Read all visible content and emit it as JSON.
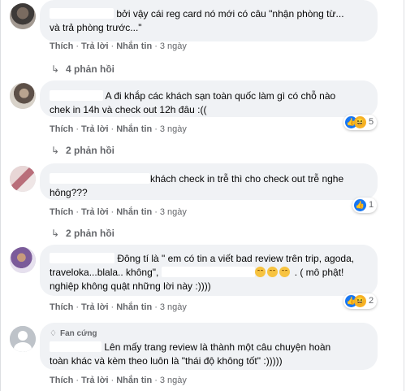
{
  "actions": {
    "like": "Thích",
    "reply": "Trả lời",
    "message": "Nhắn tin",
    "separator": "·"
  },
  "comments": [
    {
      "text_lines": [
        "bởi vậy cái reg card nó mới có câu \"nhận phòng từ...",
        "và trả phòng trước...\""
      ],
      "time": "3 ngày",
      "replies": "4 phản hồi",
      "avatar": "avatar-photo"
    },
    {
      "text_lines": [
        "A đi khắp các khách sạn toàn quốc làm gì có chỗ nào",
        "chek in 14h và check out 12h đâu :(("
      ],
      "time": "3 ngày",
      "replies": "2 phản hồi",
      "reactions": {
        "icons": [
          "like-reaction-icon",
          "haha-reaction-icon"
        ],
        "count": "5"
      },
      "avatar": "avatar-photo"
    },
    {
      "text_lines": [
        "khách check in trễ thì cho check out trễ nghe",
        "hông???"
      ],
      "time": "3 ngày",
      "replies": "2 phản hồi",
      "reactions": {
        "icons": [
          "like-reaction-icon"
        ],
        "count": "1"
      },
      "avatar": "avatar-photo"
    },
    {
      "text_lines": [
        "Đông tí là \" em có tin a viết bad review trên trip, agoda,",
        "traveloka...blala.. không\",",
        ". ( mô phật!",
        "nghiệp không quật những lời này :))))"
      ],
      "time": "3 ngày",
      "reactions": {
        "icons": [
          "like-reaction-icon",
          "haha-reaction-icon"
        ],
        "count": "2"
      },
      "avatar": "avatar-photo"
    },
    {
      "badge": "Fan cứng",
      "text_lines": [
        "Lên mấy trang review là thành một câu chuyện hoàn",
        "toàn khác và kèm theo luôn là \"thái độ không tốt\" :)))))"
      ],
      "time": "3 ngày",
      "avatar": "default-avatar"
    }
  ],
  "colors": {
    "bubble": "#f0f2f5",
    "meta": "#65676b",
    "like": "#1877f2",
    "haha": "#f7b125"
  }
}
